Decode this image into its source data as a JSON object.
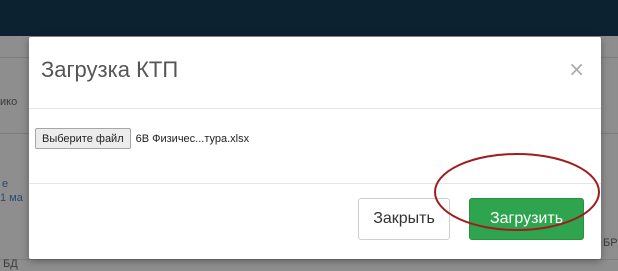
{
  "background": {
    "fragments": [
      "ико",
      "e",
      "1 ма",
      "БР",
      "БД"
    ]
  },
  "modal": {
    "title": "Загрузка КТП",
    "close_glyph": "×",
    "file_button_label": "Выберите файл",
    "file_name": "6В Физичес...тура.xlsx",
    "close_button_label": "Закрыть",
    "upload_button_label": "Загрузить"
  },
  "colors": {
    "topbar": "#0c2231",
    "upload_button": "#2ea44f",
    "annotation_ellipse": "#a01c1c"
  }
}
